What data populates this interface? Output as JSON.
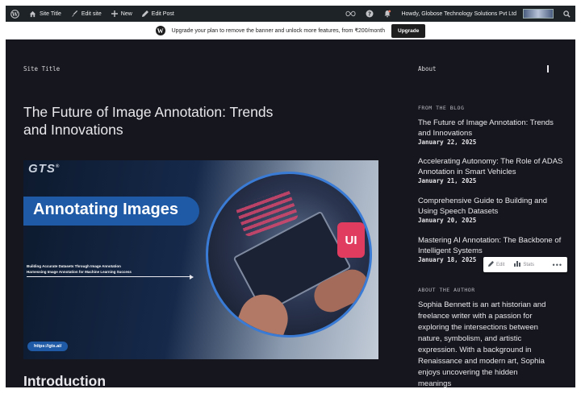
{
  "adminbar": {
    "site_title": "Site Title",
    "edit_site": "Edit site",
    "new": "New",
    "edit_post": "Edit Post",
    "howdy": "Howdy, Globose Technology Solutions Pvt Ltd"
  },
  "banner": {
    "text": "Upgrade your plan to remove the banner and unlock more features, from ₹200/month",
    "button": "Upgrade"
  },
  "site": {
    "title": "Site Title",
    "nav_about": "About"
  },
  "post": {
    "title": "The Future of Image Annotation: Trends and Innovations",
    "intro_heading": "Introduction"
  },
  "featured_image": {
    "logo": "GTS",
    "headline": "Annotating Images",
    "line1": "Building Accurate Datasets Through Image Annotation",
    "line2": "Harnessing Image Annotation for Machine Learning Success",
    "url": "https://gts.ai/",
    "badge": "UI"
  },
  "sidebar": {
    "from_blog_heading": "FROM THE BLOG",
    "posts": [
      {
        "title": "The Future of Image Annotation: Trends and Innovations",
        "date": "January 22, 2025"
      },
      {
        "title": "Accelerating Autonomy: The Role of ADAS Annotation in Smart Vehicles",
        "date": "January 21, 2025"
      },
      {
        "title": "Comprehensive Guide to Building and Using Speech Datasets",
        "date": "January 20, 2025"
      },
      {
        "title": "Mastering AI Annotation: The Backbone of Intelligent Systems",
        "date": "January 18, 2025"
      }
    ],
    "about_author_heading": "ABOUT THE AUTHOR",
    "author_bio": "Sophia Bennett is an art historian and freelance writer with a passion for exploring the intersections between nature, symbolism, and artistic expression. With a background in Renaissance and modern art, Sophia enjoys uncovering the hidden meanings"
  },
  "floating_toolbar": {
    "edit": "Edit",
    "stats": "Stats",
    "more": "•••"
  },
  "colors": {
    "adminbar_bg": "#1d2327",
    "site_bg": "#16161e",
    "accent_blue": "#1f5aa6"
  },
  "icons": [
    "wordpress-icon",
    "home-icon",
    "brush-icon",
    "plus-icon",
    "pencil-icon",
    "infinity-icon",
    "help-icon",
    "notification-icon",
    "search-icon",
    "bar-chart-icon"
  ]
}
